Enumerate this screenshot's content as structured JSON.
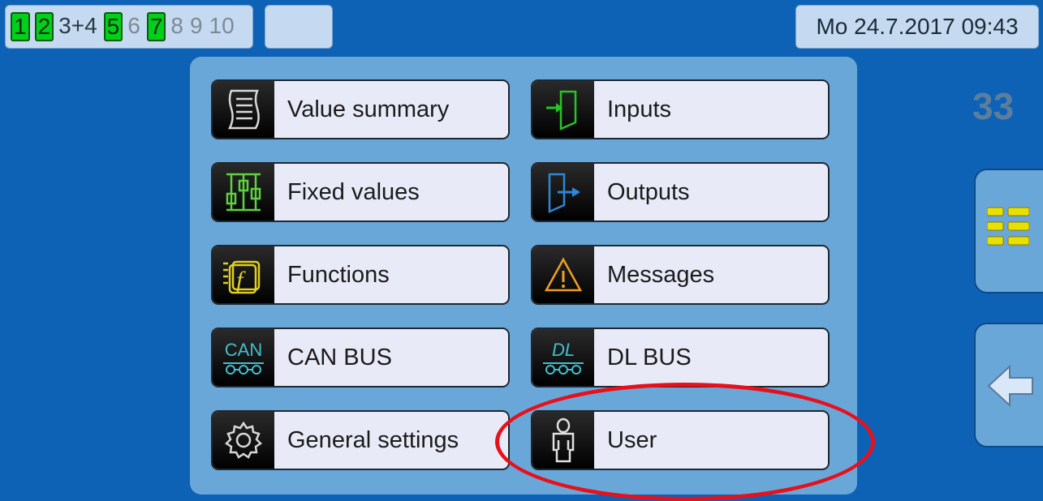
{
  "header": {
    "pages": [
      {
        "label": "1",
        "state": "active"
      },
      {
        "label": "2",
        "state": "active"
      },
      {
        "label": "3+4",
        "state": "plain"
      },
      {
        "label": "5",
        "state": "active"
      },
      {
        "label": "6",
        "state": "inactive"
      },
      {
        "label": "7",
        "state": "active"
      },
      {
        "label": "8",
        "state": "inactive"
      },
      {
        "label": "9",
        "state": "inactive"
      },
      {
        "label": "10",
        "state": "inactive"
      }
    ],
    "datetime": "Mo 24.7.2017 09:43"
  },
  "menu": {
    "value_summary": "Value summary",
    "inputs": "Inputs",
    "fixed_values": "Fixed values",
    "outputs": "Outputs",
    "functions": "Functions",
    "messages": "Messages",
    "can_bus": "CAN BUS",
    "dl_bus": "DL BUS",
    "general_settings": "General settings",
    "user": "User",
    "can_icon_text": "CAN",
    "dl_icon_text": "DL"
  },
  "side": {
    "number": "33"
  },
  "colors": {
    "background": "#0e62b6",
    "panel": "#6aa7d9",
    "active_page": "#00d01a",
    "highlight": "#e8101a"
  }
}
